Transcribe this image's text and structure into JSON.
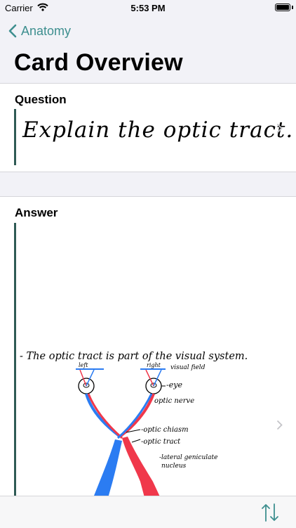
{
  "status": {
    "carrier": "Carrier",
    "time": "5:53 PM"
  },
  "nav": {
    "back_label": "Anatomy"
  },
  "title": "Card Overview",
  "question": {
    "label": "Question",
    "handwritten_text": "Explain the optic tract."
  },
  "answer": {
    "label": "Answer",
    "handwritten_text": "- The optic tract is part of the visual system.",
    "diagram_labels": {
      "left": "left",
      "right": "right",
      "visual_field": "visual field",
      "eye": "-eye",
      "optic_nerve": "optic nerve",
      "optic_chiasm": "-optic chiasm",
      "optic_tract": "-optic tract",
      "lateral_geniculate": "-lateral geniculate",
      "nucleus": "nucleus"
    }
  },
  "colors": {
    "accent": "#3e8f8f",
    "blue": "#2b7cf2",
    "red": "#f0384b",
    "bar": "#2f5a55"
  },
  "icons": {
    "back": "chevron-left-icon",
    "wifi": "wifi-icon",
    "battery": "battery-icon",
    "disclosure": "chevron-right-icon",
    "sort": "sort-arrows-icon"
  }
}
